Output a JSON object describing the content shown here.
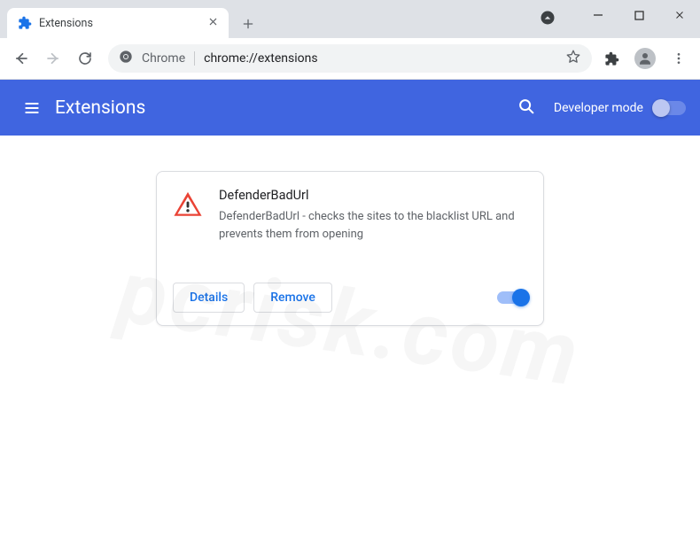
{
  "window": {
    "tab_title": "Extensions"
  },
  "omnibox": {
    "chrome_label": "Chrome",
    "url": "chrome://extensions"
  },
  "header": {
    "title": "Extensions",
    "dev_mode_label": "Developer mode"
  },
  "extension": {
    "name": "DefenderBadUrl",
    "description": "DefenderBadUrl - checks the sites to the blacklist URL and prevents them from opening",
    "details_label": "Details",
    "remove_label": "Remove",
    "enabled": true
  },
  "watermark": "pcrisk.com"
}
